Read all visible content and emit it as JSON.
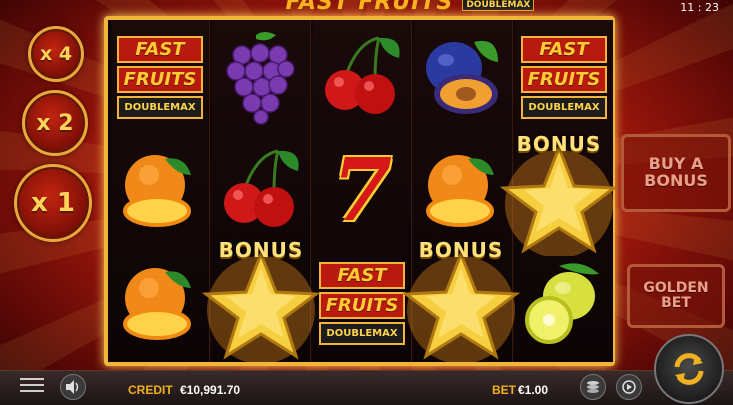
{
  "header": {
    "game_title": "FAST FRUITS",
    "title_badge": "DOUBLEMAX",
    "clock": "11 : 23"
  },
  "multipliers": [
    "x 4",
    "x 2",
    "x 1"
  ],
  "reels": {
    "logo_line1": "FAST",
    "logo_line2": "FRUITS",
    "logo_badge": "DOUBLEMAX",
    "bonus_label": "BONUS",
    "seven_symbol": "7",
    "symbols": [
      [
        "fast-fruits-logo",
        "orange",
        "orange"
      ],
      [
        "grapes",
        "cherries",
        "bonus-star"
      ],
      [
        "cherries",
        "seven",
        "fast-fruits-logo"
      ],
      [
        "plum",
        "orange",
        "bonus-star"
      ],
      [
        "fast-fruits-logo",
        "bonus-star",
        "lemon"
      ]
    ]
  },
  "side_buttons": {
    "buy_bonus_line1": "BUY A",
    "buy_bonus_line2": "BONUS",
    "golden_bet_line1": "GOLDEN",
    "golden_bet_line2": "BET"
  },
  "bottom_bar": {
    "credit_label": "CREDIT",
    "credit_value": "€10,991.70",
    "bet_label": "BET",
    "bet_value": "€1.00"
  },
  "icons": [
    "menu-icon",
    "sound-icon",
    "coin-stack-icon",
    "autoplay-icon",
    "spin-icon"
  ],
  "colors": {
    "gold": "#f2b53a",
    "red": "#b81a10",
    "frame_glow": "#ffcf5a"
  }
}
